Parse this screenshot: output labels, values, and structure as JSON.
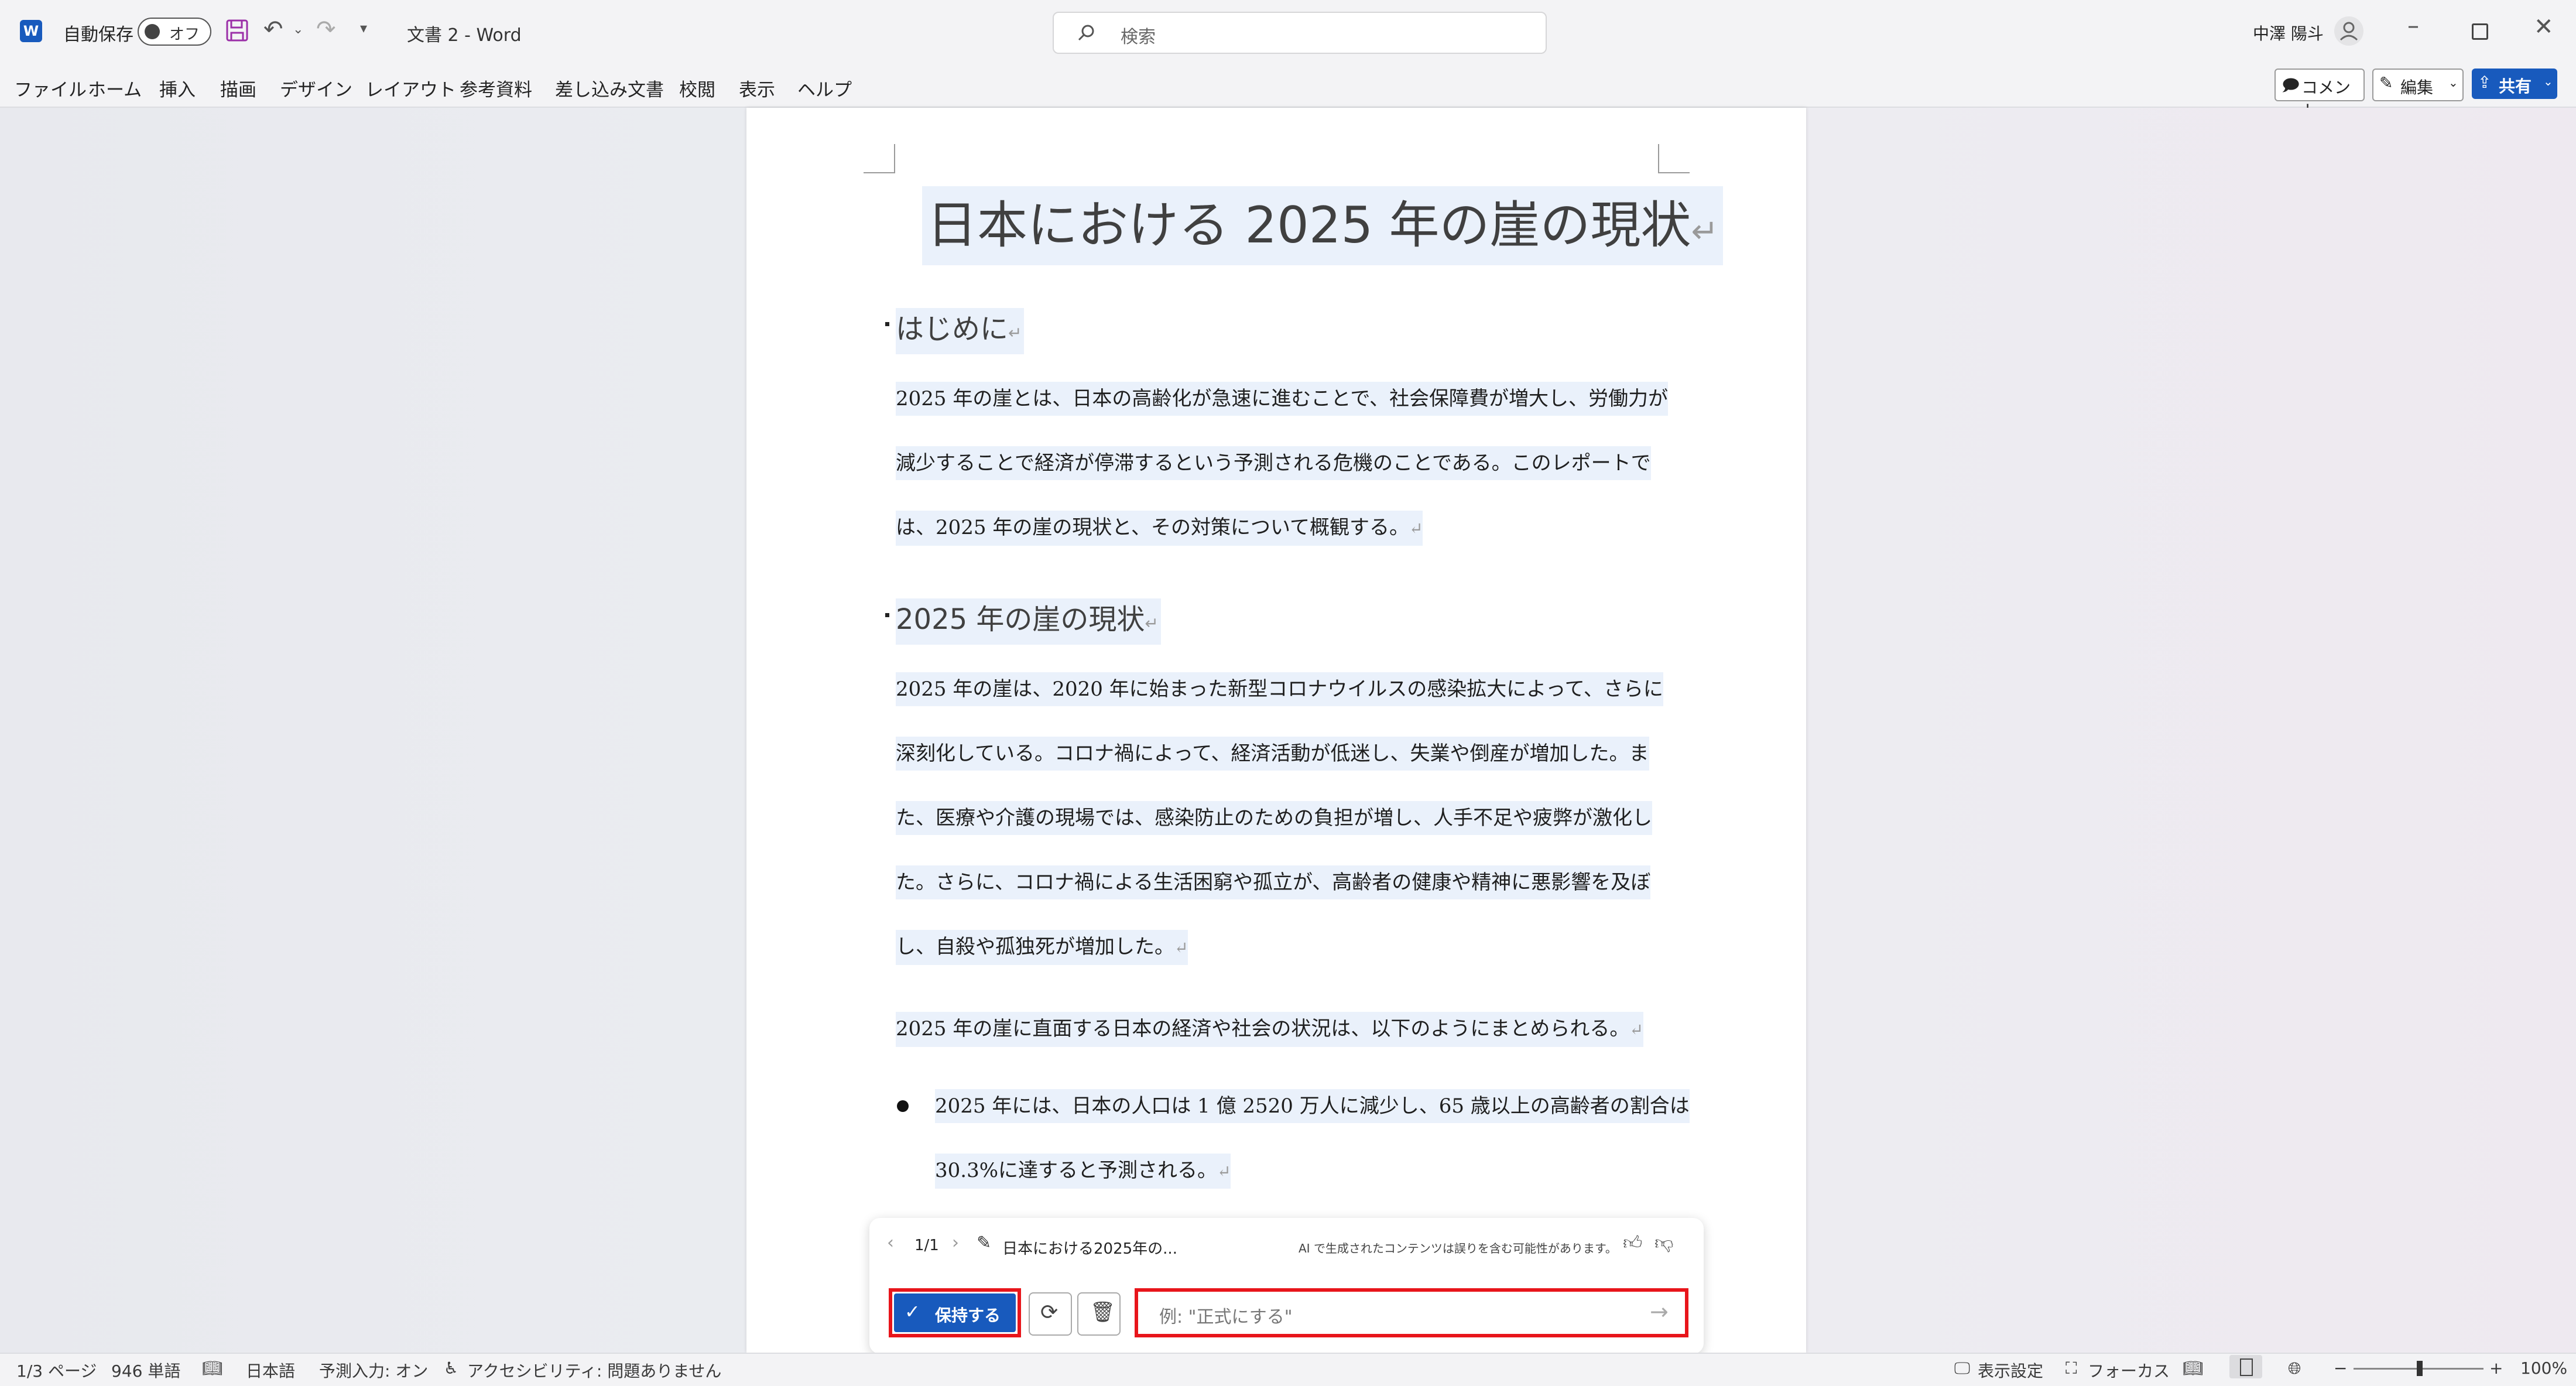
{
  "titlebar": {
    "autosave_label": "自動保存",
    "autosave_state": "オフ",
    "doc_title": "文書 2 - Word",
    "search_placeholder": "検索",
    "user_name": "中澤 陽斗"
  },
  "menu": {
    "items": [
      "ファイル",
      "ホーム",
      "挿入",
      "描画",
      "デザイン",
      "レイアウト",
      "参考資料",
      "差し込み文書",
      "校閲",
      "表示",
      "ヘルプ"
    ],
    "comment_label": "コメント",
    "edit_label": "編集",
    "share_label": "共有"
  },
  "document": {
    "title": "日本における 2025 年の崖の現状",
    "h1": "はじめに",
    "p1": [
      "2025 年の崖とは、日本の高齢化が急速に進むことで、社会保障費が増大し、労働力が",
      "減少することで経済が停滞するという予測される危機のことである。このレポートで",
      "は、2025 年の崖の現状と、その対策について概観する。"
    ],
    "h2": "2025 年の崖の現状",
    "p2": [
      "2025 年の崖は、2020 年に始まった新型コロナウイルスの感染拡大によって、さらに",
      "深刻化している。コロナ禍によって、経済活動が低迷し、失業や倒産が増加した。ま",
      "た、医療や介護の現場では、感染防止のための負担が増し、人手不足や疲弊が激化し",
      "た。さらに、コロナ禍による生活困窮や孤立が、高齢者の健康や精神に悪影響を及ぼ",
      "し、自殺や孤独死が増加した。"
    ],
    "p3": "2025 年の崖に直面する日本の経済や社会の状況は、以下のようにまとめられる。",
    "bullet1": [
      "2025 年には、日本の人口は 1 億 2520 万人に減少し、65 歳以上の高齢者の割合は",
      "30.3%に達すると予測される。"
    ]
  },
  "ai_panel": {
    "pager": "1/1",
    "draft_title": "日本における2025年の...",
    "disclaimer": "AI で生成されたコンテンツは誤りを含む可能性があります。",
    "keep_label": "保持する",
    "input_placeholder": "例: \"正式にする\""
  },
  "status": {
    "page": "1/3 ページ",
    "words": "946 単語",
    "language": "日本語",
    "predict": "予測入力: オン",
    "accessibility": "アクセシビリティ: 問題ありません",
    "display_settings": "表示設定",
    "focus": "フォーカス",
    "zoom": "100%"
  },
  "colors": {
    "accent": "#185abd",
    "highlight": "#eaf1fb",
    "red_outline": "#e8151b"
  }
}
